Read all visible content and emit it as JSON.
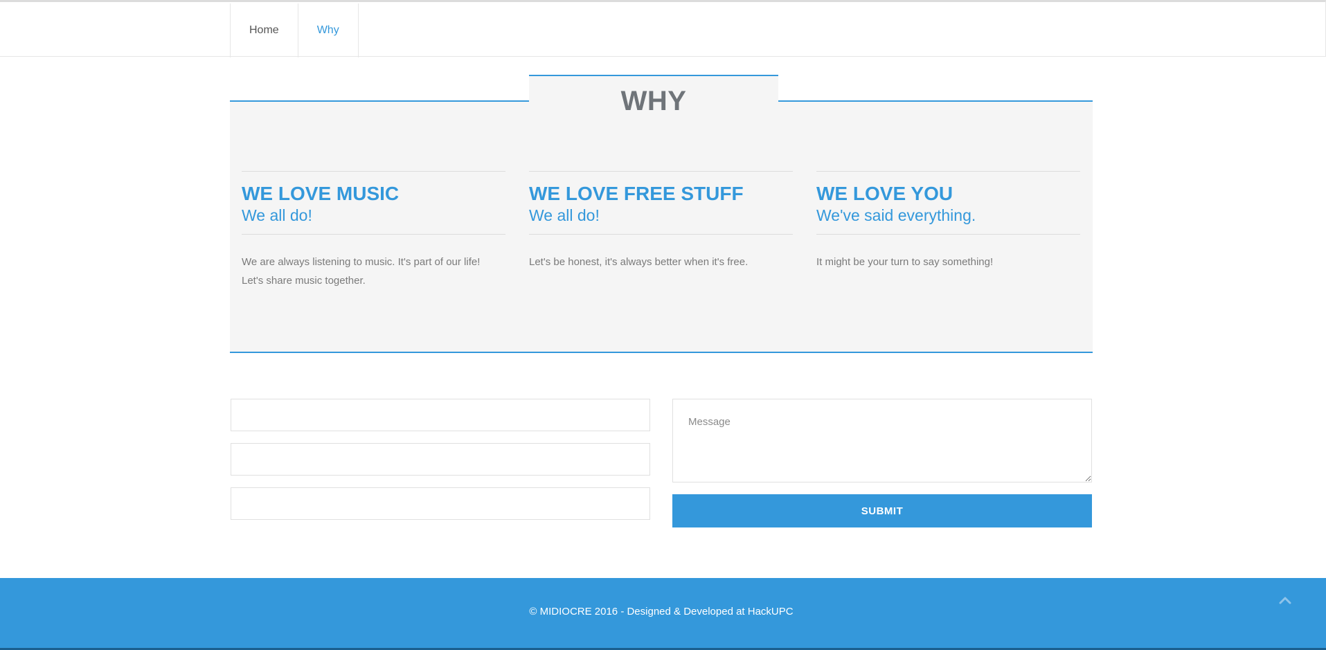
{
  "nav": {
    "items": [
      {
        "label": "Home"
      },
      {
        "label": "Why"
      }
    ]
  },
  "why": {
    "title": "WHY",
    "columns": [
      {
        "heading": "WE LOVE MUSIC",
        "subheading": "We all do!",
        "text_lines": [
          "We are always listening to music. It's part of our life!",
          "Let's share music together."
        ]
      },
      {
        "heading": "WE LOVE FREE STUFF",
        "subheading": "We all do!",
        "text_lines": [
          "Let's be honest, it's always better when it's free."
        ]
      },
      {
        "heading": "WE LOVE YOU",
        "subheading": "We've said everything.",
        "text_lines": [
          "It might be your turn to say something!"
        ]
      }
    ]
  },
  "form": {
    "name_value": "",
    "email_value": "",
    "subject_value": "",
    "message_placeholder": "Message",
    "submit_label": "SUBMIT"
  },
  "footer": {
    "text": "© MIDIOCRE 2016 - Designed & Developed at HackUPC"
  },
  "colors": {
    "accent": "#3498db",
    "panel": "#f5f5f5",
    "title_gray": "#6f7479"
  },
  "icons": {
    "back_to_top": "chevron-up-icon"
  }
}
